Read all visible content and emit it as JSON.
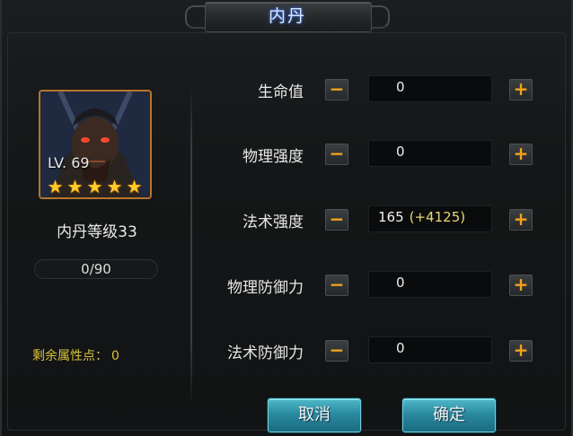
{
  "window": {
    "title": "内丹"
  },
  "hero": {
    "level_label": "LV. 69",
    "stars": 5,
    "dan_level_label": "内丹等级33",
    "exp_text": "0/90",
    "remaining_points_label": "剩余属性点：",
    "remaining_points_value": "0"
  },
  "stats": [
    {
      "label": "生命值",
      "value": "0",
      "bonus": ""
    },
    {
      "label": "物理强度",
      "value": "0",
      "bonus": ""
    },
    {
      "label": "法术强度",
      "value": "165",
      "bonus": "(+4125)"
    },
    {
      "label": "物理防御力",
      "value": "0",
      "bonus": ""
    },
    {
      "label": "法术防御力",
      "value": "0",
      "bonus": ""
    }
  ],
  "controls": {
    "minus_symbol": "−",
    "plus_symbol": "+"
  },
  "buttons": {
    "cancel": "取消",
    "confirm": "确定"
  },
  "colors": {
    "accent_orange": "#f5a21b",
    "title_glow": "#3b6bd8",
    "points_yellow": "#d9c23a",
    "button_teal": "#2b8aa0"
  }
}
